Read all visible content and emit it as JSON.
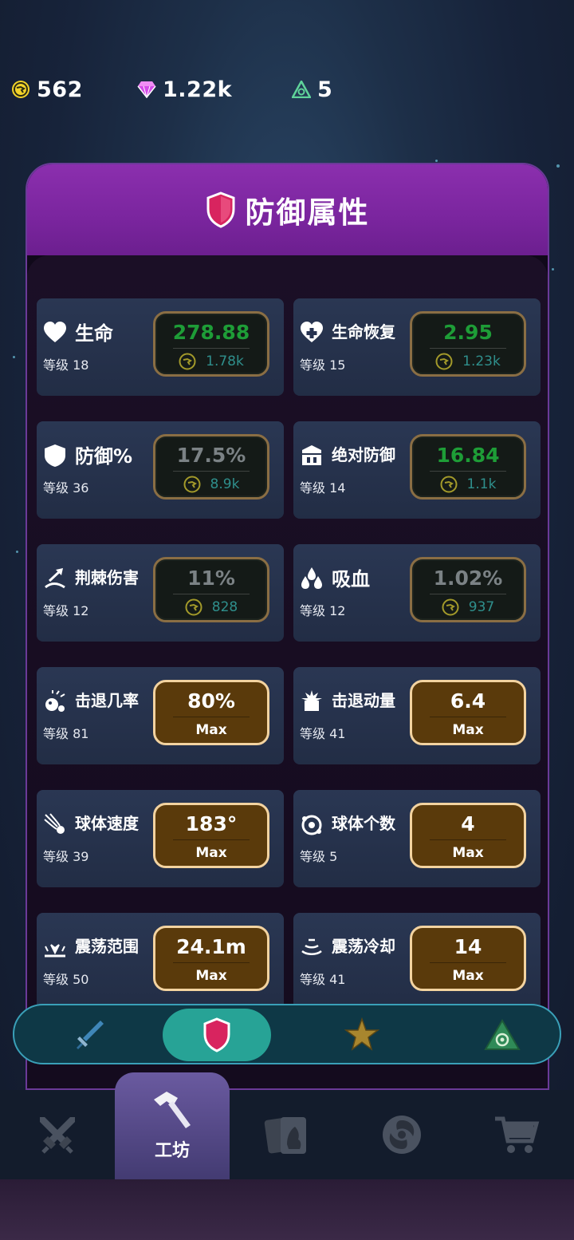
{
  "currencies": {
    "gold": "562",
    "gems": "1.22k",
    "tokens": "5"
  },
  "panel": {
    "title": "防御属性"
  },
  "level_prefix": "等级",
  "stats": [
    {
      "name": "生命",
      "level": "等级 18",
      "value": "278.88",
      "cost": "1.78k",
      "state": "upgrade",
      "value_color": "green",
      "icon": "heart-icon"
    },
    {
      "name": "生命恢复",
      "level": "等级 15",
      "value": "2.95",
      "cost": "1.23k",
      "state": "upgrade",
      "value_color": "green",
      "icon": "heart-plus-icon"
    },
    {
      "name": "防御%",
      "level": "等级 36",
      "value": "17.5%",
      "cost": "8.9k",
      "state": "upgrade",
      "value_color": "gray",
      "icon": "shield-icon"
    },
    {
      "name": "绝对防御",
      "level": "等级 14",
      "value": "16.84",
      "cost": "1.1k",
      "state": "upgrade",
      "value_color": "green",
      "icon": "wall-shield-icon"
    },
    {
      "name": "荆棘伤害",
      "level": "等级 12",
      "value": "11%",
      "cost": "828",
      "state": "upgrade",
      "value_color": "gray",
      "icon": "thorns-icon"
    },
    {
      "name": "吸血",
      "level": "等级 12",
      "value": "1.02%",
      "cost": "937",
      "state": "upgrade",
      "value_color": "gray",
      "icon": "blood-drops-icon"
    },
    {
      "name": "击退几率",
      "level": "等级 81",
      "value": "80%",
      "max_label": "Max",
      "state": "max",
      "icon": "knockback-icon"
    },
    {
      "name": "击退动量",
      "level": "等级 41",
      "value": "6.4",
      "max_label": "Max",
      "state": "max",
      "icon": "impact-icon"
    },
    {
      "name": "球体速度",
      "level": "等级 39",
      "value": "183°",
      "max_label": "Max",
      "state": "max",
      "icon": "comet-icon"
    },
    {
      "name": "球体个数",
      "level": "等级 5",
      "value": "4",
      "max_label": "Max",
      "state": "max",
      "icon": "orbit-icon"
    },
    {
      "name": "震荡范围",
      "level": "等级 50",
      "value": "24.1m",
      "max_label": "Max",
      "state": "max",
      "icon": "shockwave-icon"
    },
    {
      "name": "震荡冷却",
      "level": "等级 41",
      "value": "14",
      "max_label": "Max",
      "state": "max",
      "icon": "wave-cooldown-icon"
    }
  ],
  "subtabs": [
    {
      "icon": "sword-icon",
      "active": false
    },
    {
      "icon": "shield-icon",
      "active": true
    },
    {
      "icon": "star-icon",
      "active": false
    },
    {
      "icon": "eye-triangle-icon",
      "active": false
    }
  ],
  "bottom_nav": {
    "workshop_label": "工坊",
    "items": [
      "crossed-swords-icon",
      "hammer-icon",
      "cards-icon",
      "portal-icon",
      "cart-icon"
    ]
  },
  "colors": {
    "panel_header": "#8b2fae",
    "value_green": "#1e9d37",
    "max_fill": "#5a3a0b",
    "active_subtab": "#27a396",
    "cost_teal": "#2f8f8c"
  }
}
